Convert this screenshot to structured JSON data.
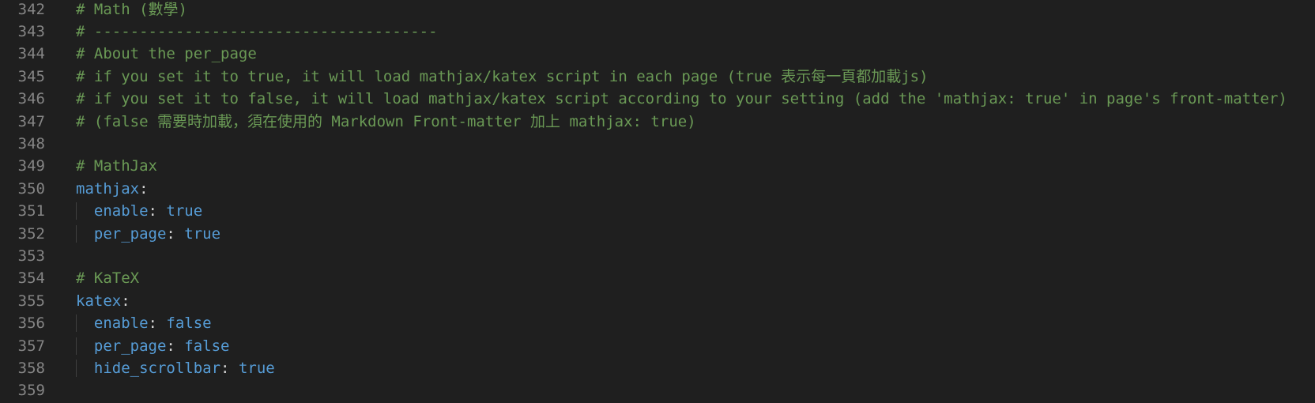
{
  "editor": {
    "lines": [
      {
        "number": "342",
        "indent": "",
        "comment": "# Math (數學)"
      },
      {
        "number": "343",
        "indent": "",
        "comment": "# --------------------------------------"
      },
      {
        "number": "344",
        "indent": "",
        "comment": "# About the per_page"
      },
      {
        "number": "345",
        "indent": "",
        "comment": "# if you set it to true, it will load mathjax/katex script in each page (true 表示每一頁都加載js)"
      },
      {
        "number": "346",
        "indent": "",
        "comment": "# if you set it to false, it will load mathjax/katex script according to your setting (add the 'mathjax: true' in page's front-matter)"
      },
      {
        "number": "347",
        "indent": "",
        "comment": "# (false 需要時加載，須在使用的 Markdown Front-matter 加上 mathjax: true)"
      },
      {
        "number": "348"
      },
      {
        "number": "349",
        "indent": "",
        "comment": "# MathJax"
      },
      {
        "number": "350",
        "indent": "",
        "key": "mathjax",
        "colon": ":"
      },
      {
        "number": "351",
        "indent": "  ",
        "guide": true,
        "key": "enable",
        "colon": ": ",
        "value": "true"
      },
      {
        "number": "352",
        "indent": "  ",
        "guide": true,
        "key": "per_page",
        "colon": ": ",
        "value": "true"
      },
      {
        "number": "353"
      },
      {
        "number": "354",
        "indent": "",
        "comment": "# KaTeX"
      },
      {
        "number": "355",
        "indent": "",
        "key": "katex",
        "colon": ":"
      },
      {
        "number": "356",
        "indent": "  ",
        "guide": true,
        "key": "enable",
        "colon": ": ",
        "value": "false"
      },
      {
        "number": "357",
        "indent": "  ",
        "guide": true,
        "key": "per_page",
        "colon": ": ",
        "value": "false"
      },
      {
        "number": "358",
        "indent": "  ",
        "guide": true,
        "key": "hide_scrollbar",
        "colon": ": ",
        "value": "true"
      },
      {
        "number": "359"
      }
    ]
  }
}
